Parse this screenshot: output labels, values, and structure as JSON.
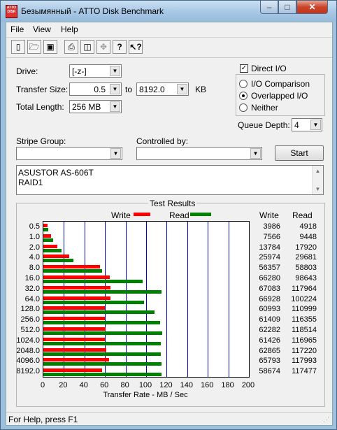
{
  "window": {
    "title": "Безымянный - ATTO Disk Benchmark",
    "close_glyph": "✕",
    "min_glyph": "–",
    "max_glyph": "□"
  },
  "menu": {
    "items": [
      "File",
      "View",
      "Help"
    ]
  },
  "toolbar": {
    "icons": [
      "new-icon",
      "open-icon",
      "save-icon",
      "print-icon",
      "print-preview-icon",
      "move-icon",
      "help-icon",
      "context-help-icon"
    ]
  },
  "settings": {
    "drive_label": "Drive:",
    "drive_value": "[-z-]",
    "transfer_size_label": "Transfer Size:",
    "transfer_from": "0.5",
    "to_label": "to",
    "transfer_to": "8192.0",
    "kb_label": "KB",
    "total_length_label": "Total Length:",
    "total_length_value": "256 MB"
  },
  "options": {
    "direct_io_label": "Direct I/O",
    "direct_io_checked": true,
    "io_comparison_label": "I/O Comparison",
    "overlapped_io_label": "Overlapped I/O",
    "neither_label": "Neither",
    "selected": "Overlapped I/O",
    "queue_depth_label": "Queue Depth:",
    "queue_depth_value": "4"
  },
  "stripe_group_label": "Stripe Group:",
  "controlled_by_label": "Controlled by:",
  "start_label": "Start",
  "description_lines": [
    "ASUSTOR AS-606T",
    "RAID1"
  ],
  "results": {
    "title": "Test Results",
    "write_legend": "Write",
    "read_legend": "Read",
    "write_header": "Write",
    "read_header": "Read",
    "write_color": "#ff0000",
    "read_color": "#008000"
  },
  "chart_data": {
    "type": "bar",
    "orientation": "horizontal",
    "xlabel": "Transfer Rate - MB / Sec",
    "xlim": [
      0,
      200
    ],
    "xticks": [
      "0",
      "20",
      "40",
      "60",
      "80",
      "100",
      "120",
      "140",
      "160",
      "180",
      "200"
    ],
    "categories": [
      "0.5",
      "1.0",
      "2.0",
      "4.0",
      "8.0",
      "16.0",
      "32.0",
      "64.0",
      "128.0",
      "256.0",
      "512.0",
      "1024.0",
      "2048.0",
      "4096.0",
      "8192.0"
    ],
    "series": [
      {
        "name": "Write",
        "values": [
          3986,
          7566,
          13784,
          25974,
          56357,
          66280,
          67083,
          66928,
          60993,
          61409,
          62282,
          61426,
          62865,
          65793,
          58674
        ]
      },
      {
        "name": "Read",
        "values": [
          4918,
          9448,
          17920,
          29681,
          58803,
          98643,
          117964,
          100224,
          110999,
          116355,
          118514,
          116965,
          117220,
          117993,
          117477
        ]
      }
    ],
    "units": "KB/s values; bars plotted in MB/s"
  },
  "status": {
    "text": "For Help, press F1"
  }
}
